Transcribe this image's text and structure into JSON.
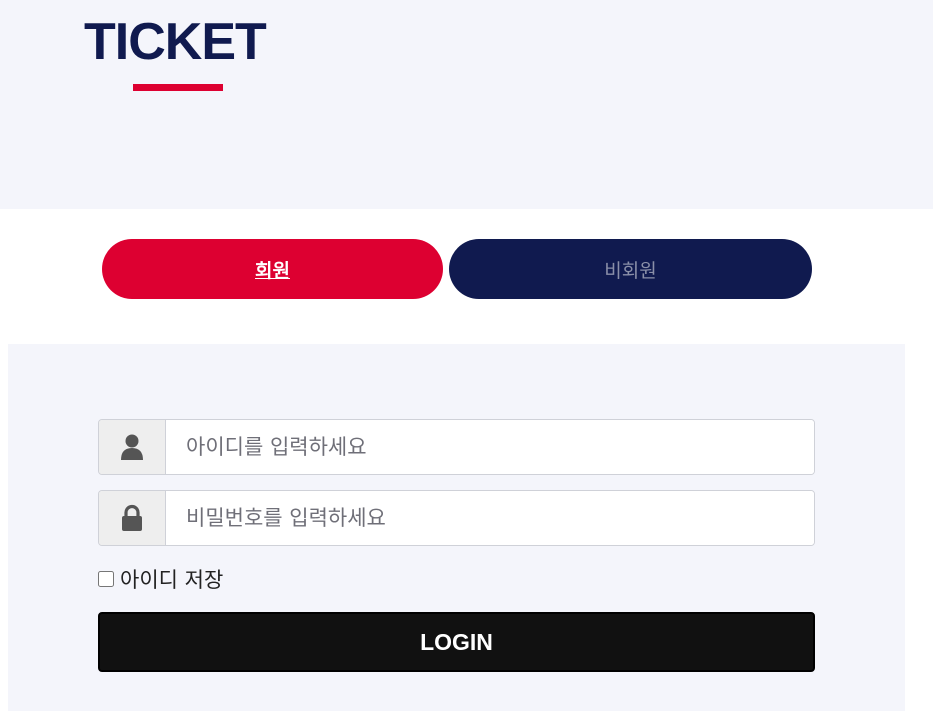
{
  "header": {
    "brand": "TICKET",
    "accent_color": "#dd0031",
    "brand_color": "#101a4f"
  },
  "tabs": [
    {
      "label": "회원",
      "active": true
    },
    {
      "label": "비회원",
      "active": false
    }
  ],
  "login_form": {
    "id_field": {
      "placeholder": "아이디를 입력하세요",
      "icon": "user-icon"
    },
    "password_field": {
      "placeholder": "비밀번호를 입력하세요",
      "icon": "lock-icon"
    },
    "remember_label": "아이디 저장",
    "remember_checked": false,
    "submit_label": "LOGIN"
  }
}
